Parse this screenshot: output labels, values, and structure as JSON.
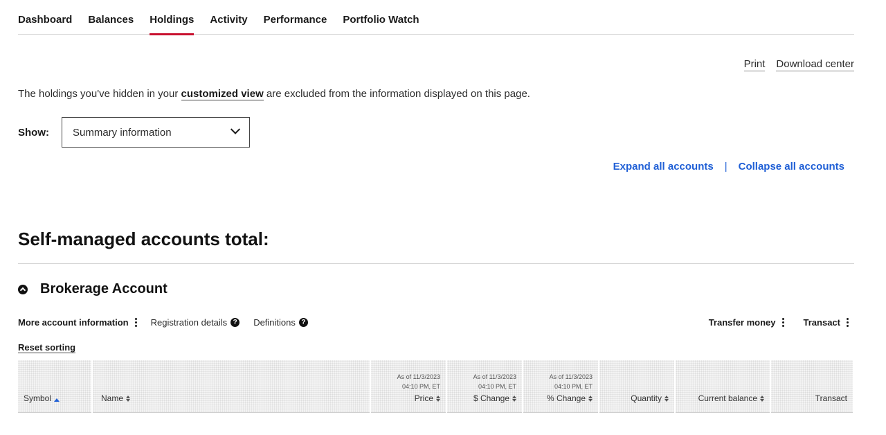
{
  "nav": {
    "items": [
      "Dashboard",
      "Balances",
      "Holdings",
      "Activity",
      "Performance",
      "Portfolio Watch"
    ],
    "active": "Holdings"
  },
  "utility": {
    "print": "Print",
    "download": "Download center"
  },
  "notice": {
    "before": "The holdings you've hidden in your ",
    "link": "customized view",
    "after": " are excluded from the information displayed on this page."
  },
  "show": {
    "label": "Show:",
    "selected": "Summary information"
  },
  "expand": {
    "expand_all": "Expand all accounts",
    "separator": "|",
    "collapse_all": "Collapse all accounts"
  },
  "section": {
    "title": "Self-managed accounts total:"
  },
  "account": {
    "title": "Brokerage Account",
    "more_info": "More account information",
    "registration": "Registration details",
    "definitions": "Definitions",
    "transfer": "Transfer money",
    "transact": "Transact",
    "reset_sorting": "Reset sorting"
  },
  "table": {
    "asof_date": "As of 11/3/2023",
    "asof_time": "04:10 PM, ET",
    "columns": {
      "symbol": "Symbol",
      "name": "Name",
      "price": "Price",
      "dollar_change": "$ Change",
      "pct_change": "% Change",
      "quantity": "Quantity",
      "current_balance": "Current balance",
      "transact": "Transact"
    }
  },
  "colors": {
    "accent_red": "#c8102e",
    "link_blue": "#1f5fd6"
  }
}
